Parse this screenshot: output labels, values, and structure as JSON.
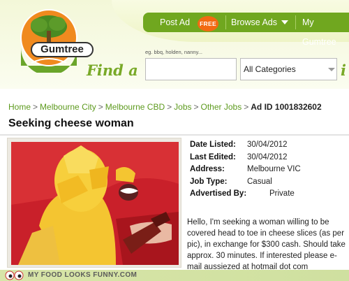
{
  "header": {
    "logo_text": "Gumtree",
    "nav": {
      "post_ad": "Post Ad",
      "free_badge": "FREE",
      "browse_ads": "Browse Ads",
      "my_gumtree": "My Gumtree"
    },
    "search": {
      "hint": "eg. bbq, holden, nanny...",
      "find_label": "Find a",
      "in_label": "i",
      "query_value": "",
      "category_selected": "All Categories"
    }
  },
  "breadcrumb": {
    "items": [
      "Home",
      "Melbourne City",
      "Melbourne CBD",
      "Jobs",
      "Other Jobs"
    ],
    "separator": ">",
    "ad_id": "Ad ID 1001832602"
  },
  "ad": {
    "title": "Seeking cheese woman",
    "details": [
      {
        "label": "Date Listed:",
        "value": "30/04/2012"
      },
      {
        "label": "Last Edited:",
        "value": "30/04/2012"
      },
      {
        "label": "Address:",
        "value": "Melbourne VIC"
      },
      {
        "label": "Job Type:",
        "value": "Casual"
      },
      {
        "label": "Advertised By:",
        "value": "Private"
      }
    ],
    "description": "Hello, I'm seeking a woman willing to be covered head to toe in cheese slices (as per pic), in exchange for $300 cash. Should take approx. 30 minutes. If interested please e-mail aussiezed at hotmail dot com"
  },
  "footer": {
    "watermark": "MY FOOD LOOKS FUNNY.COM"
  },
  "colors": {
    "nav_green": "#70a71f",
    "free_orange": "#f26a12",
    "link_green": "#5d9a1e",
    "find_green": "#79a928"
  }
}
